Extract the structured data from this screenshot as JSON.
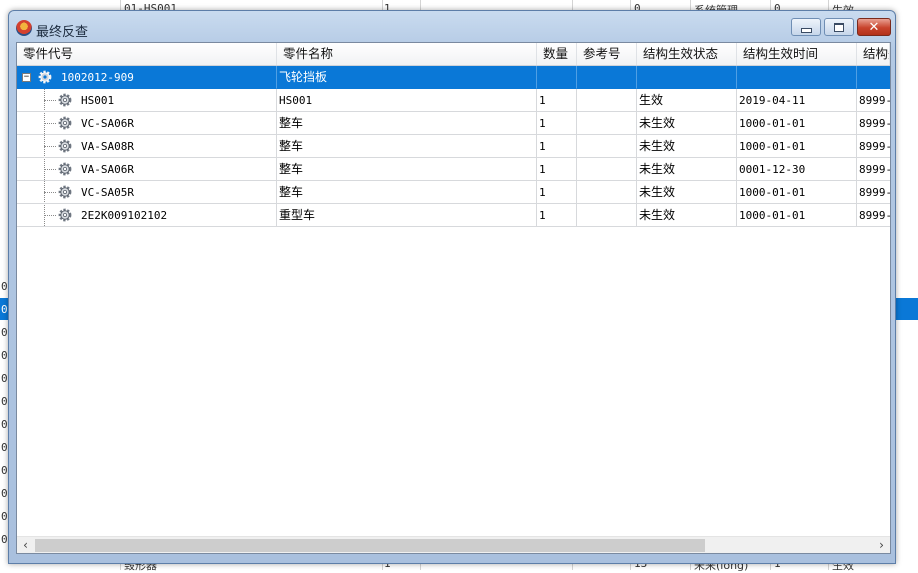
{
  "background": {
    "texts": [
      "01-HS001",
      "1",
      "0",
      "系统管理",
      "0",
      "生效"
    ],
    "bottom_texts": [
      "毁形器",
      "1",
      "13",
      "未来(iong)",
      "1",
      "生效"
    ],
    "row_mark": "0"
  },
  "window": {
    "title": "最终反查",
    "controls": {
      "minimize": "minimize",
      "maximize": "maximize",
      "close": "close"
    }
  },
  "grid": {
    "columns": [
      "零件代号",
      "零件名称",
      "数量",
      "参考号",
      "结构生效状态",
      "结构生效时间",
      "结构失"
    ],
    "root": {
      "code": "1002012-909",
      "name": "飞轮挡板",
      "qty": "",
      "ref": "",
      "status": "",
      "time": "",
      "end": "",
      "expander": "−"
    },
    "rows": [
      {
        "code": "HS001",
        "name": "HS001",
        "qty": "1",
        "ref": "",
        "status": "生效",
        "time": "2019-04-11",
        "end": "8999-"
      },
      {
        "code": "VC-SA06R",
        "name": "整车",
        "qty": "1",
        "ref": "",
        "status": "未生效",
        "time": "1000-01-01",
        "end": "8999-"
      },
      {
        "code": "VA-SA08R",
        "name": "整车",
        "qty": "1",
        "ref": "",
        "status": "未生效",
        "time": "1000-01-01",
        "end": "8999-"
      },
      {
        "code": "VA-SA06R",
        "name": "整车",
        "qty": "1",
        "ref": "",
        "status": "未生效",
        "time": "0001-12-30",
        "end": "8999-"
      },
      {
        "code": "VC-SA05R",
        "name": "整车",
        "qty": "1",
        "ref": "",
        "status": "未生效",
        "time": "1000-01-01",
        "end": "8999-"
      },
      {
        "code": "2E2K009102102",
        "name": "重型车",
        "qty": "1",
        "ref": "",
        "status": "未生效",
        "time": "1000-01-01",
        "end": "8999-"
      }
    ]
  },
  "scrollbar": {
    "left_arrow": "‹",
    "right_arrow": "›"
  },
  "colors": {
    "selection": "#0a78d7",
    "title_bar": "#b3c9e4",
    "close_button": "#c8432c"
  }
}
